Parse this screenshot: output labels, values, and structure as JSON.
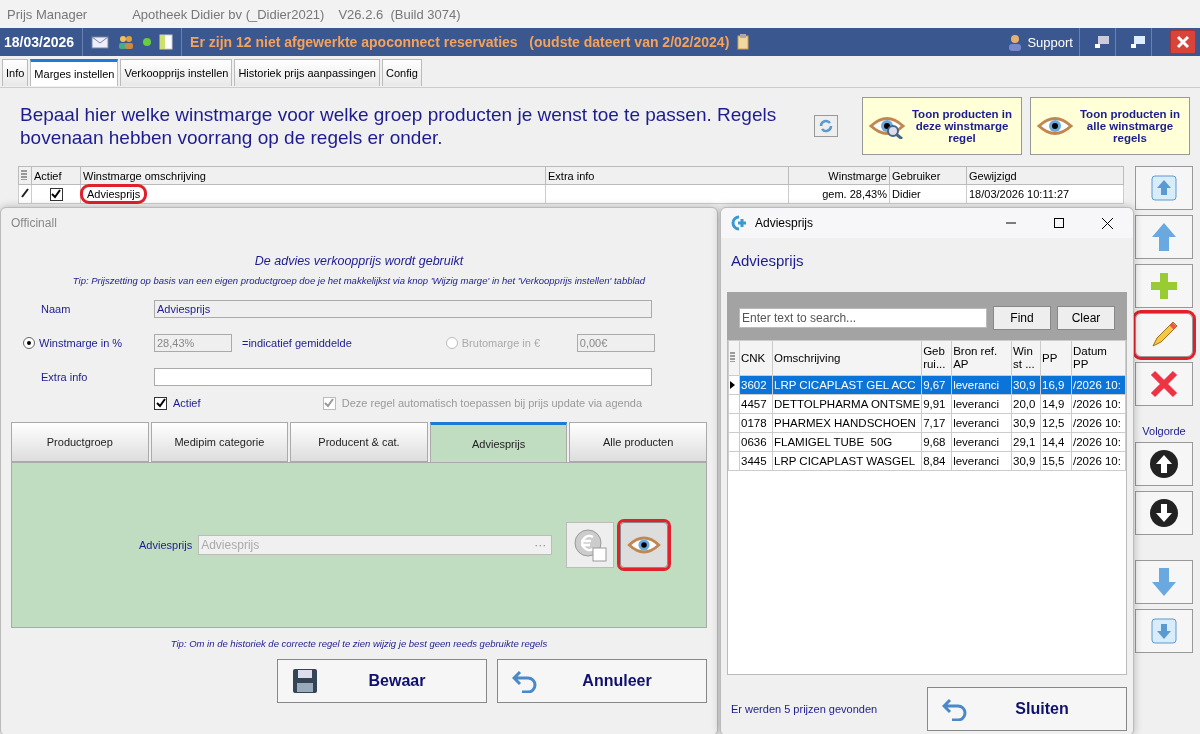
{
  "app": {
    "title": "Prijs Manager",
    "company": "Apotheek Didier bv (_Didier2021)",
    "version": "V26.2.6  (Build 3074)"
  },
  "topbar": {
    "date": "18/03/2026",
    "message": "Er zijn 12 niet afgewerkte apoconnect reservaties   (oudste dateert van 2/02/2024)",
    "support": "Support"
  },
  "tabs": [
    {
      "label": "Info",
      "selected": false
    },
    {
      "label": "Marges instellen",
      "selected": true
    },
    {
      "label": "Verkoopprijs instellen",
      "selected": false
    },
    {
      "label": "Historiek prijs aanpassingen",
      "selected": false
    },
    {
      "label": "Config",
      "selected": false
    }
  ],
  "intro": "Bepaal hier welke winstmarge voor welke groep producten je wenst toe te passen. Regels bovenaan hebben voorrang op de regels er onder.",
  "view_buttons": [
    {
      "label": "Toon producten in deze winstmarge regel",
      "kind": "search"
    },
    {
      "label": "Toon producten in alle winstmarge regels",
      "kind": "eye"
    }
  ],
  "rules_table": {
    "columns": [
      "Actief",
      "Winstmarge omschrijving",
      "Extra info",
      "Winstmarge",
      "Gebruiker",
      "Gewijzigd"
    ],
    "rows": [
      {
        "active": true,
        "description": "Adviesprijs",
        "marked": true,
        "margin": "gem. 28,43%",
        "user": "Didier",
        "modified": "18/03/2026 10:11:27"
      }
    ]
  },
  "side_buttons": [
    {
      "kind": "top",
      "marked": false
    },
    {
      "kind": "up",
      "marked": false
    },
    {
      "kind": "add",
      "marked": false
    },
    {
      "kind": "edit",
      "marked": true
    },
    {
      "kind": "delete",
      "marked": false
    }
  ],
  "order_label": "Volgorde",
  "order_buttons": [
    {
      "kind": "circle-up"
    },
    {
      "kind": "circle-down"
    },
    {
      "kind": "down"
    },
    {
      "kind": "bottom"
    }
  ],
  "editor": {
    "title": "Officinall",
    "heading": "De advies verkoopprijs wordt gebruikt",
    "tip": "Tip: Prijszetting op basis van een eigen productgroep doe je het makkelijkst via knop 'Wijzig marge' in het 'Verkoopprijs instellen' tabblad",
    "name_label": "Naam",
    "name": "Adviesprijs",
    "options": [
      {
        "label": "Winstmarge in %",
        "selected": true,
        "value": "28,43%",
        "note": "=indicatief gemiddelde"
      },
      {
        "label": "Brutomarge in €",
        "selected": false,
        "value": "0,00€"
      }
    ],
    "extra_label": "Extra info",
    "active": {
      "label": "Actief",
      "checked": true
    },
    "auto": {
      "label": "Deze regel automatisch toepassen bij prijs update via agenda",
      "checked": true
    },
    "tabs": [
      {
        "label": "Productgroep",
        "selected": false
      },
      {
        "label": "Medipim categorie",
        "selected": false
      },
      {
        "label": "Producent & cat.",
        "selected": false
      },
      {
        "label": "Adviesprijs",
        "selected": true
      },
      {
        "label": "Alle producten",
        "selected": false
      }
    ],
    "source_label": "Adviesprijs",
    "source_placeholder": "Adviesprijs",
    "source_dots": "···",
    "view_marked": true,
    "footer_tip": "Tip: Om in de historiek de correcte regel te zien wijzig je best geen reeds gebruikte regels",
    "buttons": [
      {
        "label": "Bewaar",
        "kind": "save"
      },
      {
        "label": "Annuleer",
        "kind": "cancel"
      }
    ]
  },
  "results": {
    "title": "Adviesprijs",
    "heading": "Adviesprijs",
    "search_placeholder": "Enter text to search...",
    "find": "Find",
    "clear": "Clear",
    "columns": [
      "CNK",
      "Omschrijving",
      "Geb rui...",
      "Bron ref. AP",
      "Win st ...",
      "PP",
      "Datum PP"
    ],
    "rows": [
      {
        "selected": true,
        "cells": [
          "3602",
          "LRP CICAPLAST GEL ACC",
          "9,67",
          "leveranci",
          "30,9",
          "16,9",
          "/2026 10:"
        ]
      },
      {
        "selected": false,
        "cells": [
          "4457",
          "DETTOLPHARMA ONTSME",
          "9,91",
          "leveranci",
          "20,0",
          "14,9",
          "/2026 10:"
        ]
      },
      {
        "selected": false,
        "cells": [
          "0178",
          "PHARMEX HANDSCHOEN",
          "7,17",
          "leveranci",
          "30,9",
          "12,5",
          "/2026 10:"
        ]
      },
      {
        "selected": false,
        "cells": [
          "0636",
          "FLAMIGEL TUBE  50G",
          "9,68",
          "leveranci",
          "29,1",
          "14,4",
          "/2026 10:"
        ]
      },
      {
        "selected": false,
        "cells": [
          "3445",
          "LRP CICAPLAST WASGEL",
          "8,84",
          "leveranci",
          "30,9",
          "15,5",
          "/2026 10:"
        ]
      }
    ],
    "status": "Er werden 5 prijzen gevonden",
    "close": "Sluiten"
  }
}
